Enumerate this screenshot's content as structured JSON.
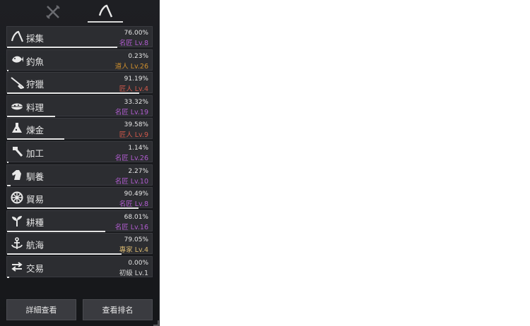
{
  "tabs": [
    {
      "icon": "crossed-swords-icon",
      "active": false
    },
    {
      "icon": "sickle-icon",
      "active": true
    }
  ],
  "skills": [
    {
      "name": "採集",
      "percent": "76.00%",
      "level": "名匠 Lv.8",
      "progress": 0.76,
      "icon": "sickle-icon",
      "level_color": "#b05ccf"
    },
    {
      "name": "釣魚",
      "percent": "0.23%",
      "level": "道人 Lv.26",
      "progress": 0.0023,
      "icon": "fish-icon",
      "level_color": "#d0902e"
    },
    {
      "name": "狩獵",
      "percent": "91.19%",
      "level": "匠人 Lv.4",
      "progress": 0.9119,
      "icon": "rifle-icon",
      "level_color": "#d0584a"
    },
    {
      "name": "料理",
      "percent": "33.32%",
      "level": "名匠 Lv.19",
      "progress": 0.3332,
      "icon": "cooking-pot-icon",
      "level_color": "#b05ccf"
    },
    {
      "name": "煉金",
      "percent": "39.58%",
      "level": "匠人 Lv.9",
      "progress": 0.3958,
      "icon": "flask-icon",
      "level_color": "#d0584a"
    },
    {
      "name": "加工",
      "percent": "1.14%",
      "level": "名匠 Lv.26",
      "progress": 0.0114,
      "icon": "hammer-icon",
      "level_color": "#b05ccf"
    },
    {
      "name": "馴養",
      "percent": "2.27%",
      "level": "名匠 Lv.10",
      "progress": 0.0227,
      "icon": "horse-icon",
      "level_color": "#b05ccf"
    },
    {
      "name": "貿易",
      "percent": "90.49%",
      "level": "名匠 Lv.8",
      "progress": 0.9049,
      "icon": "wheel-icon",
      "level_color": "#b05ccf"
    },
    {
      "name": "耕種",
      "percent": "68.01%",
      "level": "名匠 Lv.16",
      "progress": 0.6801,
      "icon": "sprout-icon",
      "level_color": "#b05ccf"
    },
    {
      "name": "航海",
      "percent": "79.05%",
      "level": "專家 Lv.4",
      "progress": 0.7905,
      "icon": "anchor-icon",
      "level_color": "#d8b870"
    },
    {
      "name": "交易",
      "percent": "0.00%",
      "level": "初級 Lv.1",
      "progress": 0.0,
      "icon": "exchange-arrows-icon",
      "level_color": "#d8d8d8"
    }
  ],
  "buttons": {
    "details": "詳細查看",
    "ranking": "查看排名"
  }
}
